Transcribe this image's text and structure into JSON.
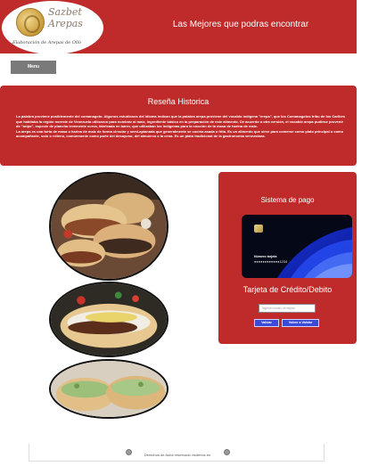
{
  "header": {
    "logo_name_line1": "Sazbet",
    "logo_name_line2": "Arepas",
    "logo_tagline": "Elaboración de Arepas de Ollo",
    "title": "Las Mejores que podras encontrar"
  },
  "nav": {
    "menu_label": "Menu"
  },
  "history": {
    "title": "Reseña Historica",
    "paragraph1": "La palabra proviene posiblemente del cumanagoto. Algunos estudiosos del idioma indican que la palabra arepa proviene del vocablo indígena \"erepa\", que los Cumanagotos tribu de los Caribes que habitaba la región noreste de Venezuela utilizaron para nombrar al maíz, ingrediente básico en la preparación de este alimento. De acuerdo a otra versión, el vocablo arepa pudiese provenir de \"aripo\", especie de plancha levemente curva, fabricada en barro, que utilizaban los indígenas para la cocción de la masa de harina de maíz.",
    "paragraph2": "La arepa es una torta de masa o harina de maíz de forma circular y semi-aplanada que generalmente se cocina asada o frita. Es un alimento que sirve para comerse como plato principal o como acompañante, solo o relleno, comúnmente como parte del desayuno, del almuerzo o la cena. Es un plato tradicional de la gastronomía venezolana."
  },
  "payment": {
    "title": "Sistema de pago",
    "card_label": "Número tarjeta",
    "card_number": "●●●●●●●●●●●●1234",
    "subtitle": "Tarjeta de Crédito/Debito",
    "input_placeholder": "Ingrese numero de tarjeta",
    "validate_label": "Validar",
    "back_label": "Volver a Validar"
  },
  "footer": {
    "text": "Derechos de Autor reservado visítenos en"
  },
  "colors": {
    "brand_red": "#bf2b2b",
    "button_blue": "#3b4ad8",
    "menu_gray": "#7a7a7a"
  }
}
